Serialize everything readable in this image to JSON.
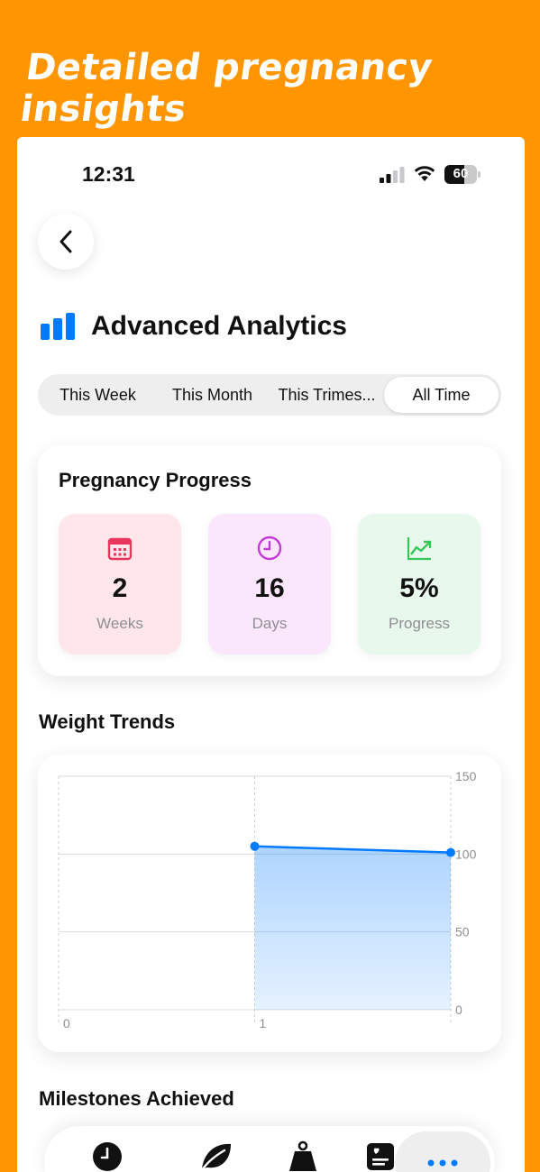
{
  "promo": {
    "title": "Detailed pregnancy insights"
  },
  "status_bar": {
    "time": "12:31",
    "battery_level": "60",
    "battery_fraction": 0.6
  },
  "header": {
    "title": "Advanced Analytics",
    "accent_color": "#007AFF"
  },
  "filter_tabs": {
    "items": [
      {
        "label": "This Week",
        "selected": false
      },
      {
        "label": "This Month",
        "selected": false
      },
      {
        "label": "This Trimes...",
        "selected": false
      },
      {
        "label": "All Time",
        "selected": true
      }
    ]
  },
  "pregnancy_progress": {
    "title": "Pregnancy Progress",
    "stats": [
      {
        "value": "2",
        "label": "Weeks",
        "icon": "calendar-icon",
        "color": "#E8365D",
        "bg": "#FFE6EA"
      },
      {
        "value": "16",
        "label": "Days",
        "icon": "clock-icon",
        "color": "#C23BD4",
        "bg": "#FBE7FB"
      },
      {
        "value": "5%",
        "label": "Progress",
        "icon": "trend-up-icon",
        "color": "#34C759",
        "bg": "#E8F8EC"
      }
    ]
  },
  "weight_trends": {
    "title": "Weight Trends",
    "chart_data": {
      "type": "area",
      "x": [
        1,
        2
      ],
      "y": [
        105,
        101
      ],
      "xlim": [
        0,
        2
      ],
      "ylim": [
        0,
        150
      ],
      "x_ticks": [
        "0",
        "1"
      ],
      "y_ticks": [
        "0",
        "50",
        "100",
        "150"
      ],
      "grid": true,
      "color": "#007AFF"
    }
  },
  "milestones": {
    "title": "Milestones Achieved"
  },
  "tab_bar": {
    "items": [
      {
        "icon": "clock-icon"
      },
      {
        "icon": "leaf-icon"
      },
      {
        "icon": "weight-icon"
      },
      {
        "icon": "journal-icon"
      },
      {
        "icon": "more-icon",
        "selected": true
      }
    ]
  }
}
